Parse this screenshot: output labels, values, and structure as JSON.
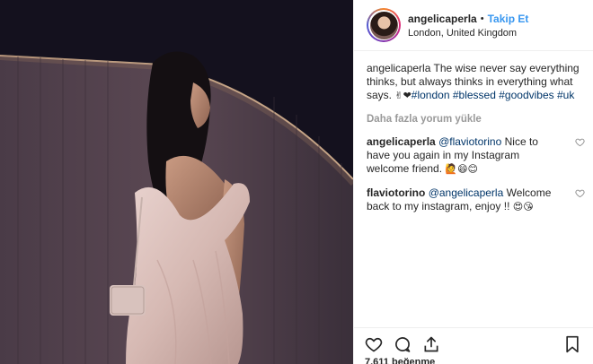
{
  "post": {
    "username": "angelicaperla",
    "separator": "•",
    "follow_label": "Takip Et",
    "location": "London, United Kingdom"
  },
  "caption": {
    "username": "angelicaperla",
    "text": "The wise never say everything thinks, but always thinks in everything what says.",
    "emoji": "✌❤",
    "hashtags": [
      "#london",
      "#blessed",
      "#goodvibes",
      "#uk"
    ]
  },
  "load_more_label": "Daha fazla yorum yükle",
  "comments": [
    {
      "username": "angelicaperla",
      "mention": "@flaviotorino",
      "text": "Nice to have you again in my Instagram welcome friend.",
      "emoji": "🙋😄😊"
    },
    {
      "username": "flaviotorino",
      "mention": "@angelicaperla",
      "text": "Welcome back to my instagram, enjoy !!",
      "emoji": "😍😘"
    }
  ],
  "likes_text": "7.611 beğenme",
  "icons": {
    "like": "heart-icon",
    "comment": "comment-icon",
    "share": "share-icon",
    "save": "bookmark-icon"
  },
  "colors": {
    "link_blue": "#3897f0",
    "hashtag": "#003569",
    "muted": "#999999",
    "text": "#262626"
  }
}
